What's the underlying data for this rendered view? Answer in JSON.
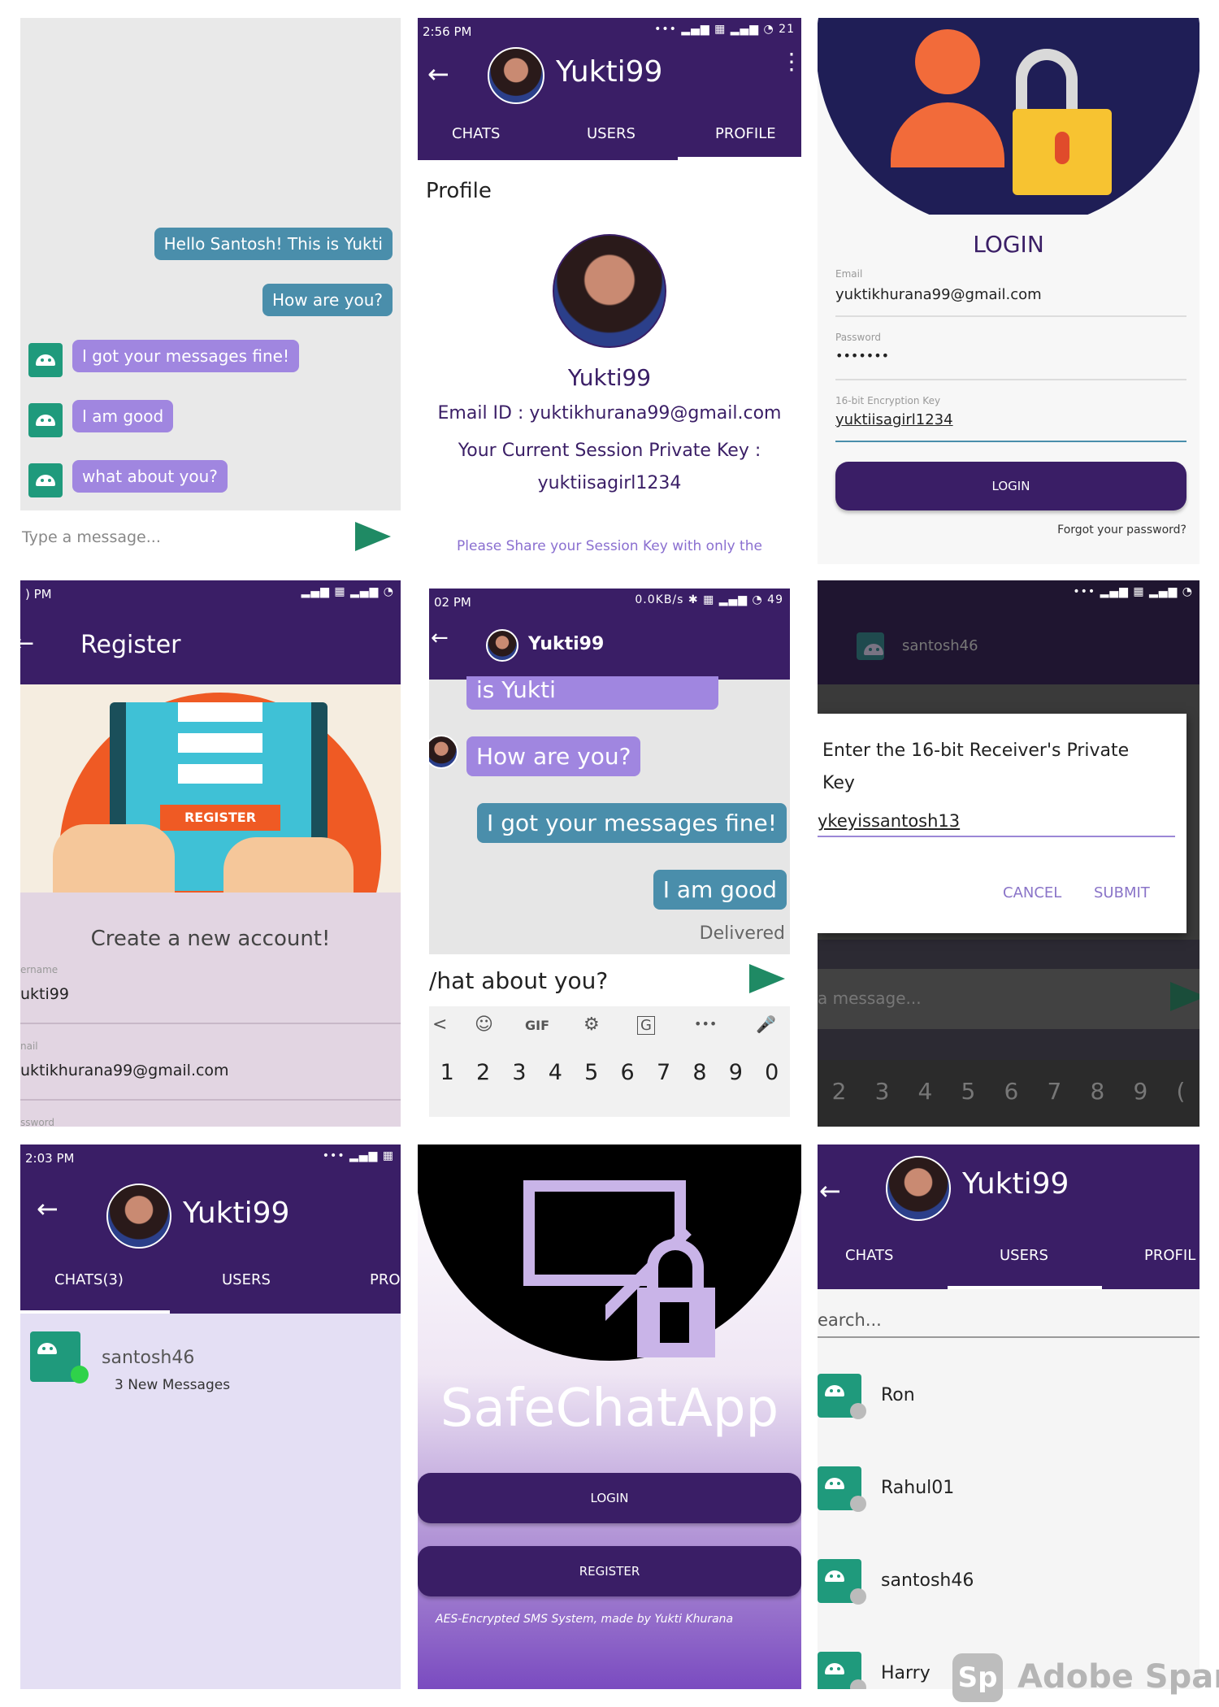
{
  "colors": {
    "purple": "#3a1e66",
    "blue_bubble": "#4a8eab",
    "lilac_bubble": "#a086e0",
    "green": "#1f8a64"
  },
  "chat1": {
    "sent": [
      "Hello Santosh! This is Yukti",
      "How are you?"
    ],
    "received": [
      "I got your messages fine!",
      "I am good",
      "what about you?"
    ],
    "input_placeholder": "Type a message..."
  },
  "profile": {
    "status_time": "2:56 PM",
    "status_battery": "21",
    "name": "Yukti99",
    "tabs": [
      "CHATS",
      "USERS",
      "PROFILE"
    ],
    "section_title": "Profile",
    "email_line": "Email ID : yuktikhurana99@gmail.com",
    "key_label": "Your Current Session Private Key :",
    "key_value": "yuktiisagirl1234",
    "note": "Please Share your Session Key with only the"
  },
  "login": {
    "title": "LOGIN",
    "email_label": "Email",
    "email_value": "yuktikhurana99@gmail.com",
    "password_label": "Password",
    "password_value": "•••••••",
    "key_label": "16-bit Encryption Key",
    "key_value": "yuktiisagirl1234",
    "button": "LOGIN",
    "forgot": "Forgot your password?"
  },
  "register": {
    "status_time": ") PM",
    "title": "Register",
    "illustration_label": "REGISTER",
    "subtitle": "Create a new account!",
    "username_label": "ername",
    "username_value": "ukti99",
    "email_label": "nail",
    "email_value": "uktikhurana99@gmail.com",
    "password_label": "ssword"
  },
  "chat2": {
    "status_time": "02 PM",
    "status_net": "0.0KB/s",
    "status_battery": "49",
    "name": "Yukti99",
    "top_bubble": "is Yukti",
    "received": "How are you?",
    "sent": [
      "I got your messages fine!",
      "I am good"
    ],
    "delivered": "Delivered",
    "input_value": "/hat about you?",
    "kb_toolbar": [
      "<",
      "☺",
      "GIF",
      "⚙",
      "G",
      "•••",
      "🎤"
    ],
    "kb_numbers": [
      "1",
      "2",
      "3",
      "4",
      "5",
      "6",
      "7",
      "8",
      "9",
      "0"
    ]
  },
  "dialog": {
    "header_name": "santosh46",
    "title": "Enter the 16-bit Receiver's Private Key",
    "value": "ykeyissantosh13",
    "cancel": "CANCEL",
    "submit": "SUBMIT",
    "bg_input": "a message...",
    "kb_numbers": [
      "2",
      "3",
      "4",
      "5",
      "6",
      "7",
      "8",
      "9",
      "("
    ]
  },
  "chats_list": {
    "status_time": "2:03 PM",
    "name": "Yukti99",
    "tabs": [
      "CHATS(3)",
      "USERS",
      "PRO"
    ],
    "item_name": "santosh46",
    "item_sub": "3 New Messages"
  },
  "splash": {
    "app_name": "SafeChatApp",
    "login": "LOGIN",
    "register": "REGISTER",
    "footer": "AES-Encrypted SMS System, made by Yukti Khurana"
  },
  "users": {
    "name": "Yukti99",
    "tabs": [
      "CHATS",
      "USERS",
      "PROFIL"
    ],
    "search_placeholder": "earch...",
    "list": [
      "Ron",
      "Rahul01",
      "santosh46",
      "Harry"
    ]
  },
  "watermark": {
    "badge": "Sp",
    "text": "Adobe Spark"
  }
}
